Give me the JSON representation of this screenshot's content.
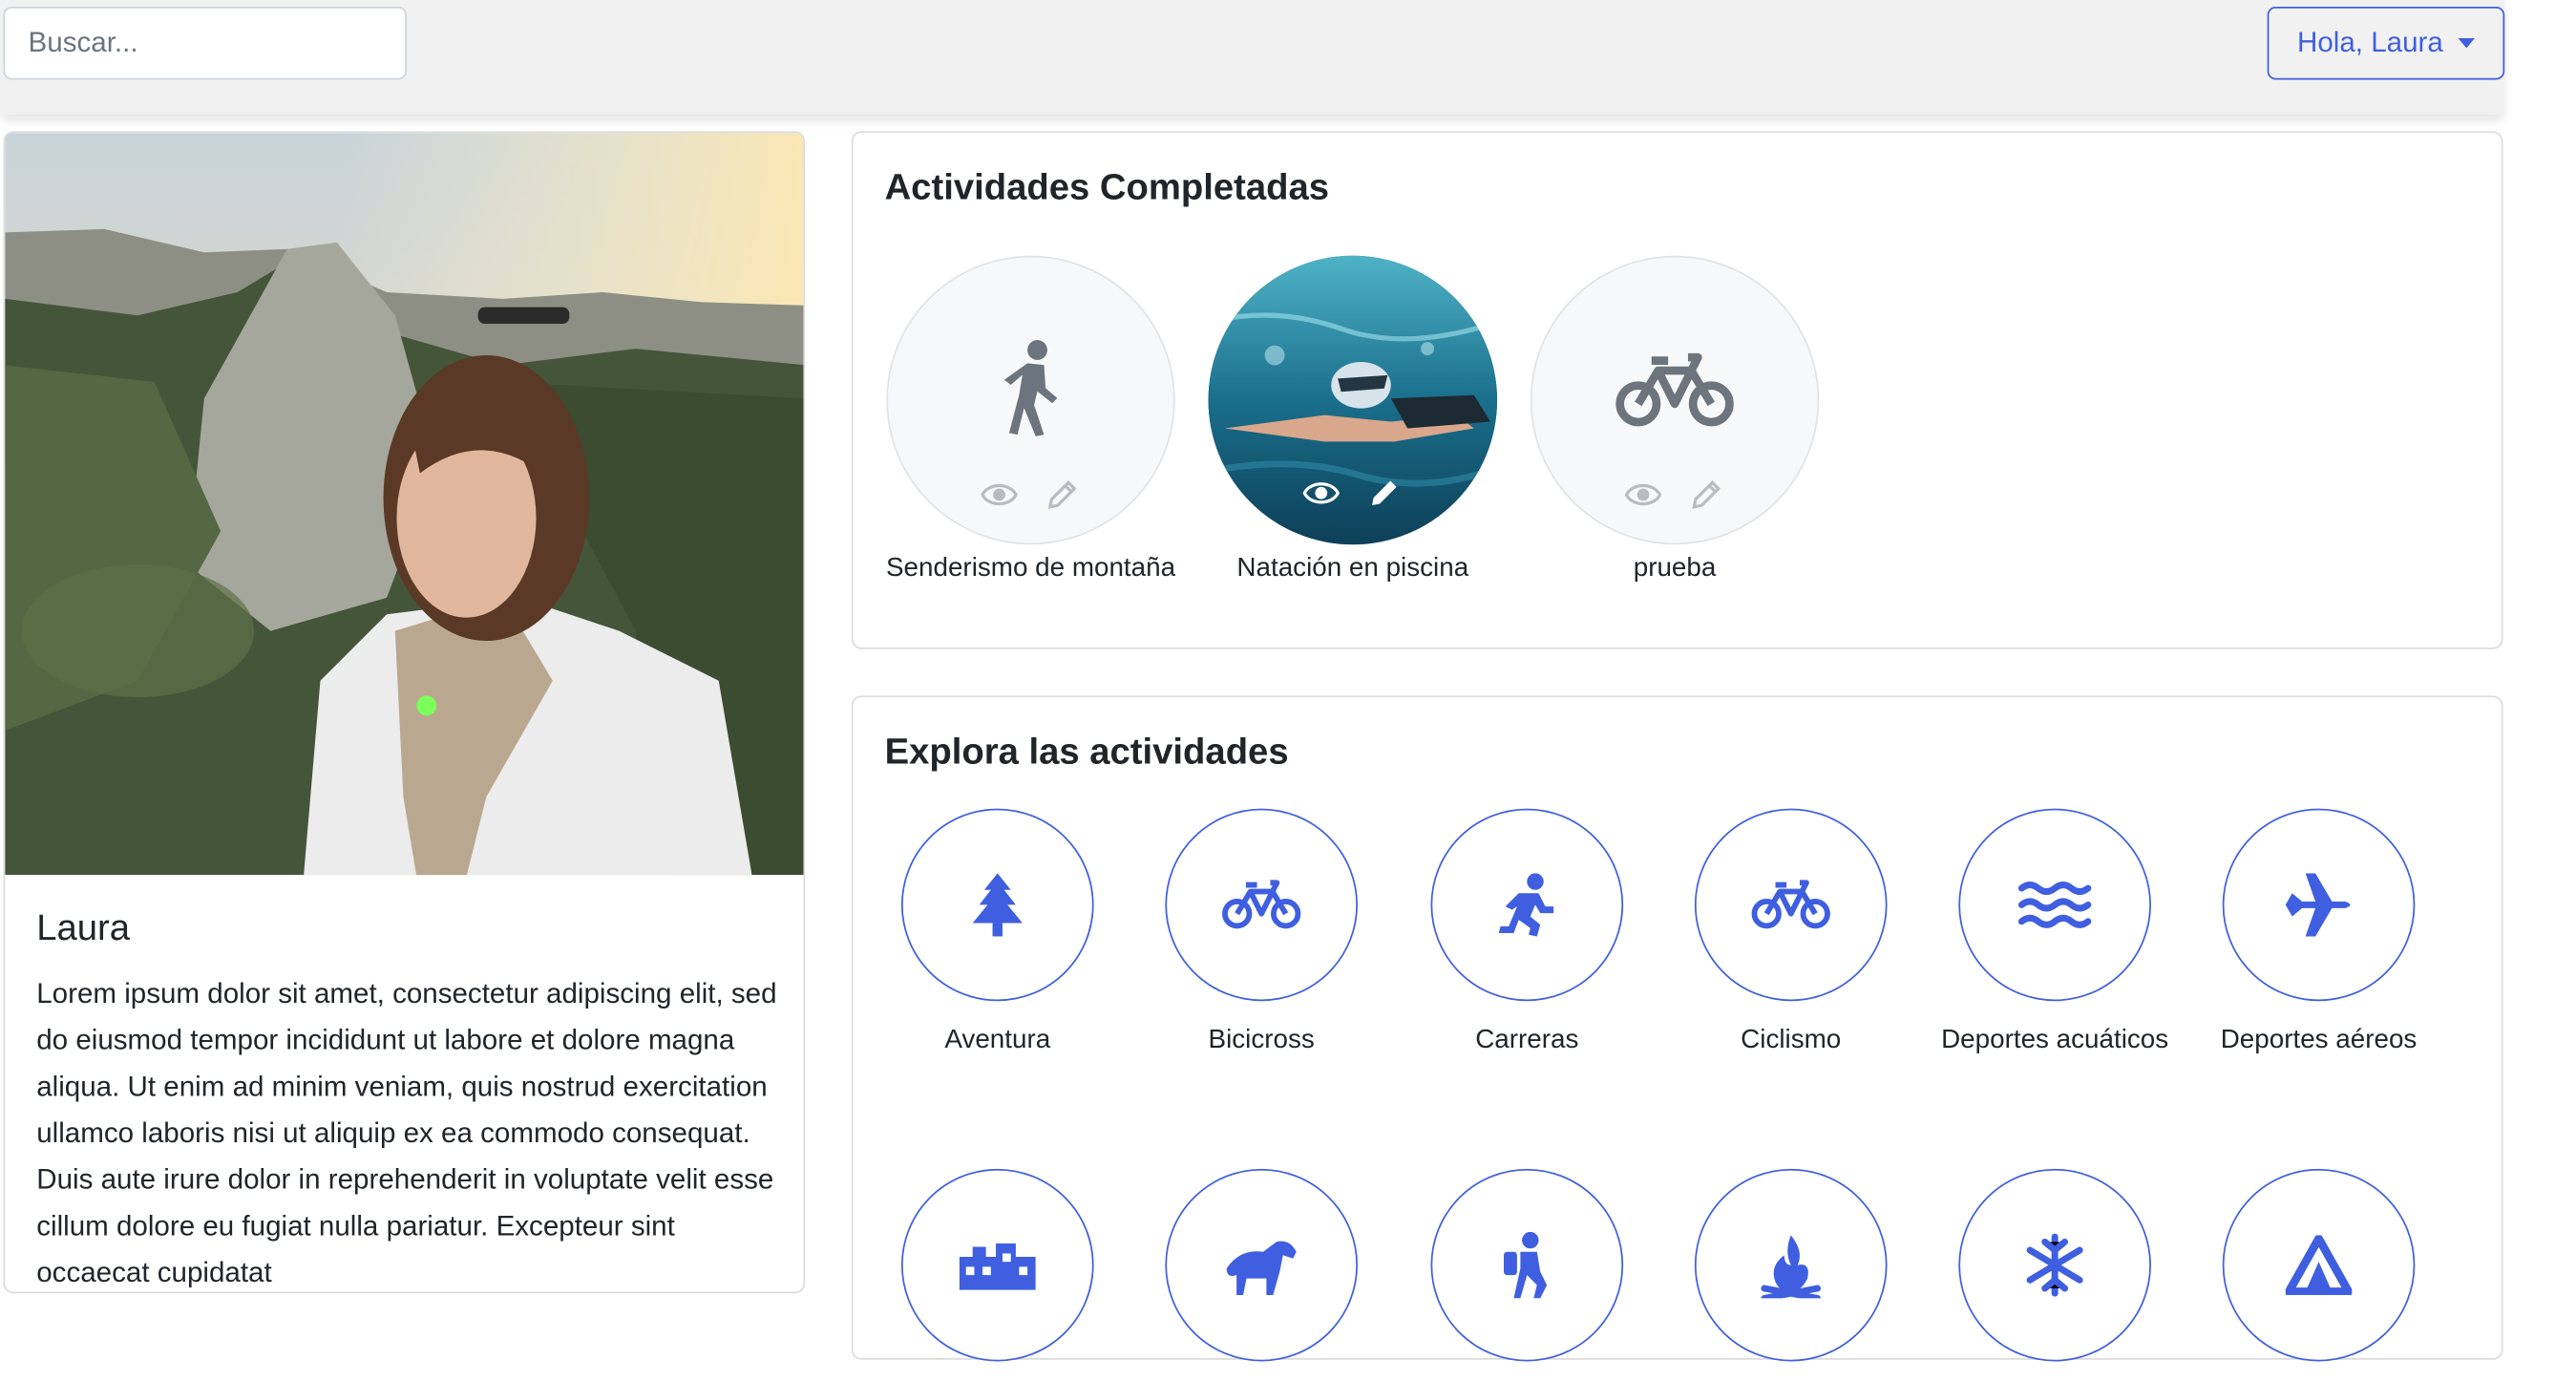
{
  "header": {
    "search_placeholder": "Buscar...",
    "user_menu_label": "Hola, Laura"
  },
  "profile": {
    "name": "Laura",
    "bio": "Lorem ipsum dolor sit amet, consectetur adipiscing elit, sed do eiusmod tempor incididunt ut labore et dolore magna aliqua. Ut enim ad minim veniam, quis nostrud exercitation ullamco laboris nisi ut aliquip ex ea commodo consequat. Duis aute irure dolor in reprehenderit in voluptate velit esse cillum dolore eu fugiat nulla pariatur. Excepteur sint occaecat cupidatat"
  },
  "completed": {
    "title": "Actividades Completadas",
    "items": [
      {
        "label": "Senderismo de montaña",
        "icon": "hiking-icon"
      },
      {
        "label": "Natación en piscina",
        "icon": "swimmer-photo"
      },
      {
        "label": "prueba",
        "icon": "bicycle-icon"
      }
    ]
  },
  "explore": {
    "title": "Explora las actividades",
    "items": [
      {
        "label": "Aventura",
        "icon": "tree-icon"
      },
      {
        "label": "Bicicross",
        "icon": "bicycle-icon"
      },
      {
        "label": "Carreras",
        "icon": "running-icon"
      },
      {
        "label": "Ciclismo",
        "icon": "bicycle-icon"
      },
      {
        "label": "Deportes acuáticos",
        "icon": "water-icon"
      },
      {
        "label": "Deportes aéreos",
        "icon": "plane-icon"
      },
      {
        "label": "",
        "icon": "industry-icon"
      },
      {
        "label": "",
        "icon": "horse-icon"
      },
      {
        "label": "",
        "icon": "hiker-icon"
      },
      {
        "label": "",
        "icon": "campfire-icon"
      },
      {
        "label": "",
        "icon": "snowflake-icon"
      },
      {
        "label": "",
        "icon": "tent-icon"
      }
    ]
  },
  "colors": {
    "accent": "#3f5fe0",
    "icon_gray": "#6c757d",
    "navbar_bg": "#f1f1f1"
  }
}
